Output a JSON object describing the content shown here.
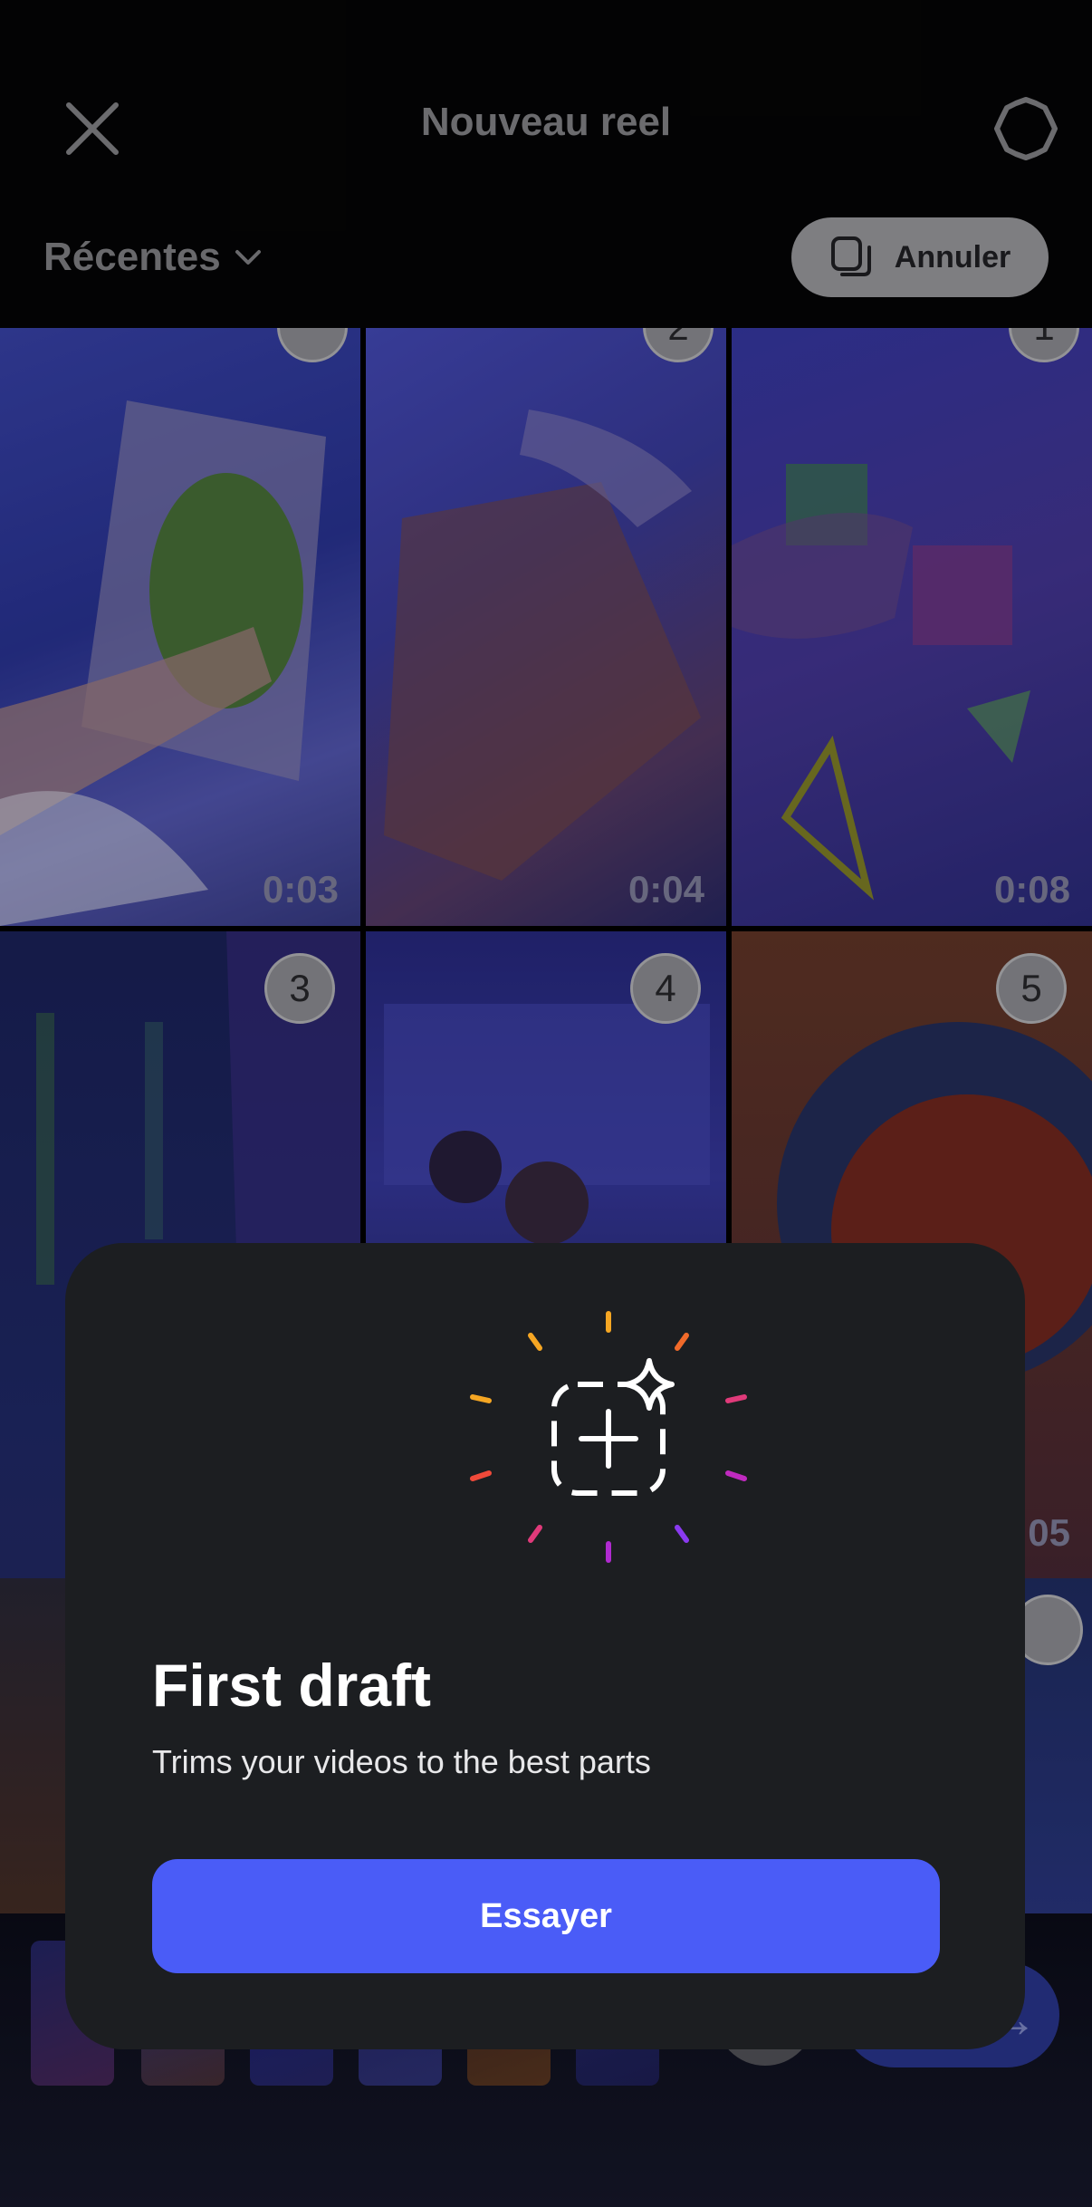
{
  "header": {
    "title": "Nouveau reel",
    "close_icon": "close-icon",
    "settings_icon": "gear-icon"
  },
  "album": {
    "label": "Récentes",
    "icon": "chevron-down-icon"
  },
  "cancel_button": {
    "label": "Annuler",
    "icon": "multi-select-icon"
  },
  "grid": {
    "items": [
      {
        "duration": "0:03",
        "badge": ""
      },
      {
        "duration": "0:04",
        "badge": "2"
      },
      {
        "duration": "0:08",
        "badge": "1"
      },
      {
        "duration": "",
        "badge": "3"
      },
      {
        "duration": "",
        "badge": "4"
      },
      {
        "duration": "05",
        "badge": "5"
      },
      {
        "duration": "",
        "badge": ""
      }
    ]
  },
  "modal": {
    "title": "First draft",
    "subtitle": "Trims your videos to the best parts",
    "button_label": "Essayer",
    "icon": "sparkle-add-icon"
  },
  "colors": {
    "accent": "#4a5cf7",
    "modal_bg": "#1c1e21"
  }
}
